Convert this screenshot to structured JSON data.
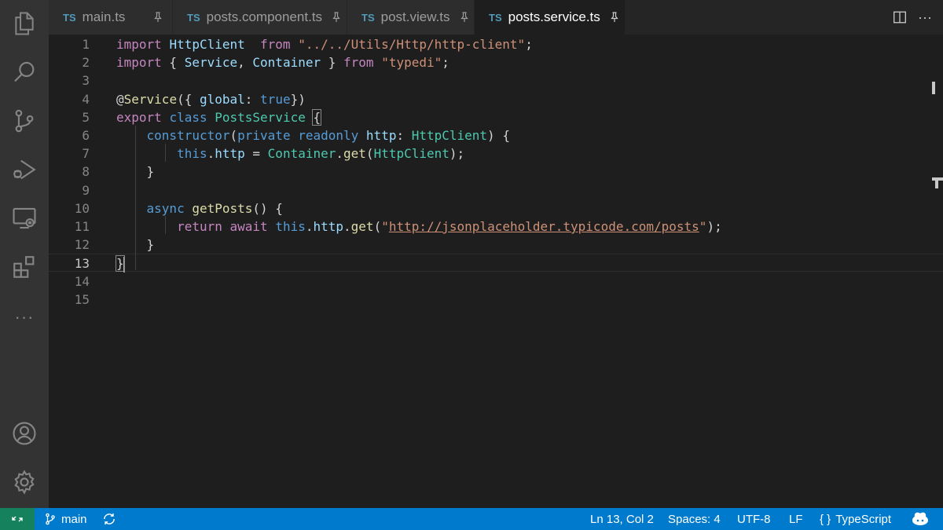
{
  "tabs": [
    {
      "badge": "TS",
      "label": "main.ts",
      "active": false
    },
    {
      "badge": "TS",
      "label": "posts.component.ts",
      "active": false
    },
    {
      "badge": "TS",
      "label": "post.view.ts",
      "active": false
    },
    {
      "badge": "TS",
      "label": "posts.service.ts",
      "active": true
    }
  ],
  "tab_actions": {
    "more_label": "···"
  },
  "activity_bar": {
    "items": [
      "explorer-icon",
      "search-icon",
      "source-control-icon",
      "run-debug-icon",
      "remote-explorer-icon",
      "extensions-icon"
    ],
    "more_label": "···",
    "bottom": [
      "accounts-icon",
      "settings-gear-icon"
    ]
  },
  "editor": {
    "line_numbers": [
      "1",
      "2",
      "3",
      "4",
      "5",
      "6",
      "7",
      "8",
      "9",
      "10",
      "11",
      "12",
      "13",
      "14",
      "15"
    ],
    "current_line": 13,
    "lines": [
      {
        "tokens": [
          {
            "t": "import",
            "c": "kw"
          },
          {
            "t": " "
          },
          {
            "t": "HttpClient",
            "c": "var"
          },
          {
            "t": "  "
          },
          {
            "t": "from",
            "c": "kw"
          },
          {
            "t": " "
          },
          {
            "t": "\"../../Utils/Http/http-client\"",
            "c": "str"
          },
          {
            "t": ";",
            "c": "pun"
          }
        ]
      },
      {
        "tokens": [
          {
            "t": "import",
            "c": "kw"
          },
          {
            "t": " { ",
            "c": "pun"
          },
          {
            "t": "Service",
            "c": "var"
          },
          {
            "t": ", ",
            "c": "pun"
          },
          {
            "t": "Container",
            "c": "var"
          },
          {
            "t": " } ",
            "c": "pun"
          },
          {
            "t": "from",
            "c": "kw"
          },
          {
            "t": " "
          },
          {
            "t": "\"typedi\"",
            "c": "str"
          },
          {
            "t": ";",
            "c": "pun"
          }
        ]
      },
      {
        "tokens": []
      },
      {
        "tokens": [
          {
            "t": "@",
            "c": "pun"
          },
          {
            "t": "Service",
            "c": "fn"
          },
          {
            "t": "({ ",
            "c": "pun"
          },
          {
            "t": "global",
            "c": "var"
          },
          {
            "t": ": ",
            "c": "pun"
          },
          {
            "t": "true",
            "c": "kb"
          },
          {
            "t": "})",
            "c": "pun"
          }
        ]
      },
      {
        "tokens": [
          {
            "t": "export",
            "c": "kw"
          },
          {
            "t": " "
          },
          {
            "t": "class",
            "c": "kb"
          },
          {
            "t": " "
          },
          {
            "t": "PostsService",
            "c": "cls"
          },
          {
            "t": " "
          },
          {
            "t": "{",
            "c": "pun",
            "hl": true
          }
        ]
      },
      {
        "tokens": [
          {
            "t": "    "
          },
          {
            "t": "constructor",
            "c": "kb"
          },
          {
            "t": "(",
            "c": "pun"
          },
          {
            "t": "private",
            "c": "kb"
          },
          {
            "t": " "
          },
          {
            "t": "readonly",
            "c": "kb"
          },
          {
            "t": " "
          },
          {
            "t": "http",
            "c": "var"
          },
          {
            "t": ": ",
            "c": "pun"
          },
          {
            "t": "HttpClient",
            "c": "cls"
          },
          {
            "t": ") {",
            "c": "pun"
          }
        ]
      },
      {
        "tokens": [
          {
            "t": "        "
          },
          {
            "t": "this",
            "c": "kb"
          },
          {
            "t": ".",
            "c": "pun"
          },
          {
            "t": "http",
            "c": "var"
          },
          {
            "t": " = ",
            "c": "pun"
          },
          {
            "t": "Container",
            "c": "cls"
          },
          {
            "t": ".",
            "c": "pun"
          },
          {
            "t": "get",
            "c": "fn"
          },
          {
            "t": "(",
            "c": "pun"
          },
          {
            "t": "HttpClient",
            "c": "cls"
          },
          {
            "t": ");",
            "c": "pun"
          }
        ]
      },
      {
        "tokens": [
          {
            "t": "    "
          },
          {
            "t": "}",
            "c": "pun"
          }
        ]
      },
      {
        "tokens": []
      },
      {
        "tokens": [
          {
            "t": "    "
          },
          {
            "t": "async",
            "c": "kb"
          },
          {
            "t": " "
          },
          {
            "t": "getPosts",
            "c": "fn"
          },
          {
            "t": "() {",
            "c": "pun"
          }
        ]
      },
      {
        "tokens": [
          {
            "t": "        "
          },
          {
            "t": "return",
            "c": "kw"
          },
          {
            "t": " "
          },
          {
            "t": "await",
            "c": "kw"
          },
          {
            "t": " "
          },
          {
            "t": "this",
            "c": "kb"
          },
          {
            "t": ".",
            "c": "pun"
          },
          {
            "t": "http",
            "c": "var"
          },
          {
            "t": ".",
            "c": "pun"
          },
          {
            "t": "get",
            "c": "fn"
          },
          {
            "t": "(",
            "c": "pun"
          },
          {
            "t": "\"",
            "c": "str"
          },
          {
            "t": "http://jsonplaceholder.typicode.com/posts",
            "c": "str",
            "u": true
          },
          {
            "t": "\"",
            "c": "str"
          },
          {
            "t": ");",
            "c": "pun"
          }
        ]
      },
      {
        "tokens": [
          {
            "t": "    "
          },
          {
            "t": "}",
            "c": "pun"
          }
        ]
      },
      {
        "tokens": [
          {
            "t": "}",
            "c": "pun",
            "hl": true,
            "cursor": true
          }
        ]
      },
      {
        "tokens": []
      },
      {
        "tokens": []
      }
    ]
  },
  "statusbar": {
    "branch": "main",
    "position": "Ln 13, Col 2",
    "spaces": "Spaces: 4",
    "encoding": "UTF-8",
    "eol": "LF",
    "language_brace": "{ }",
    "language": "TypeScript"
  },
  "colors": {
    "statusbar": "#007acc",
    "remote": "#16825d",
    "editor_bg": "#1e1e1e",
    "tab_active": "#1e1e1e",
    "tab_inactive": "#2d2d2d",
    "ts_badge": "#519aba"
  }
}
